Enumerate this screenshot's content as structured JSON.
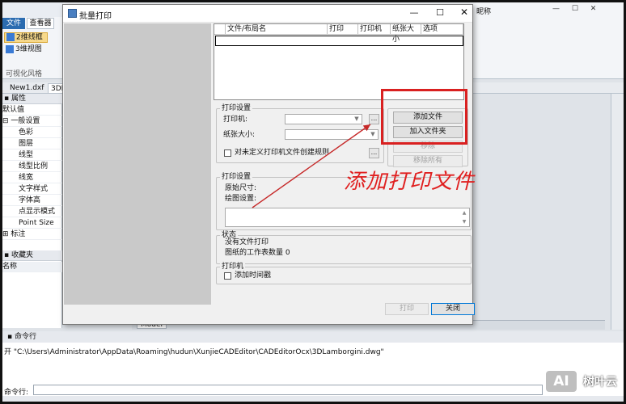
{
  "app": {
    "top_right_text": "昵称",
    "ribbon": {
      "tab_file": "文件",
      "tab_view": "查看器",
      "btn_2d_wire": "2维线框",
      "btn_3d_view": "3维视图",
      "group_label": "可视化风格"
    },
    "doc_tabs": [
      "New1.dxf",
      "3DL"
    ],
    "properties": {
      "header": "属性",
      "default": "默认值",
      "general_group": "一般设置",
      "rows": [
        "色彩",
        "图层",
        "线型",
        "线型比例",
        "线宽",
        "文字样式",
        "字体高",
        "点显示模式",
        "Point Size"
      ],
      "annotation_group": "标注",
      "favorites_header": "收藏夹",
      "name_col": "名称"
    },
    "model_tab": "Model",
    "command": {
      "header": "命令行",
      "line": "开 \"C:\\Users\\Administrator\\AppData\\Roaming\\hudun\\XunjieCADEditor\\CADEditorOcx\\3DLamborgini.dwg\"",
      "input_label": "命令行:"
    }
  },
  "dialog": {
    "title": "批量打印",
    "controls": {
      "minimize": "—",
      "maximize": "☐",
      "close": "✕"
    },
    "table_columns": [
      "文件/布局名",
      "打印",
      "打印机",
      "纸张大小",
      "选项"
    ],
    "print_settings": {
      "legend": "打印设置",
      "printer_label": "打印机:",
      "paper_label": "纸张大小:",
      "checkbox_label": "对未定义打印机文件创建规则",
      "dots": "..."
    },
    "buttons": {
      "add_file": "添加文件",
      "add_folder": "加入文件夹",
      "remove": "移除",
      "remove_all": "移除所有",
      "print": "打印",
      "close": "关闭"
    },
    "print_settings2": {
      "legend": "打印设置",
      "original_size": "原始尺寸:",
      "drawing_settings": "绘图设置:"
    },
    "status": {
      "legend": "状态",
      "no_files": "没有文件打印",
      "sheet_count": "图纸的工作表数量 0"
    },
    "printer_group": {
      "legend": "打印机",
      "add_timestamp": "添加时间戳"
    }
  },
  "annotation": {
    "text": "添加打印文件",
    "color": "#e02020"
  },
  "watermark": {
    "logo": "AI",
    "text": "树叶云"
  }
}
